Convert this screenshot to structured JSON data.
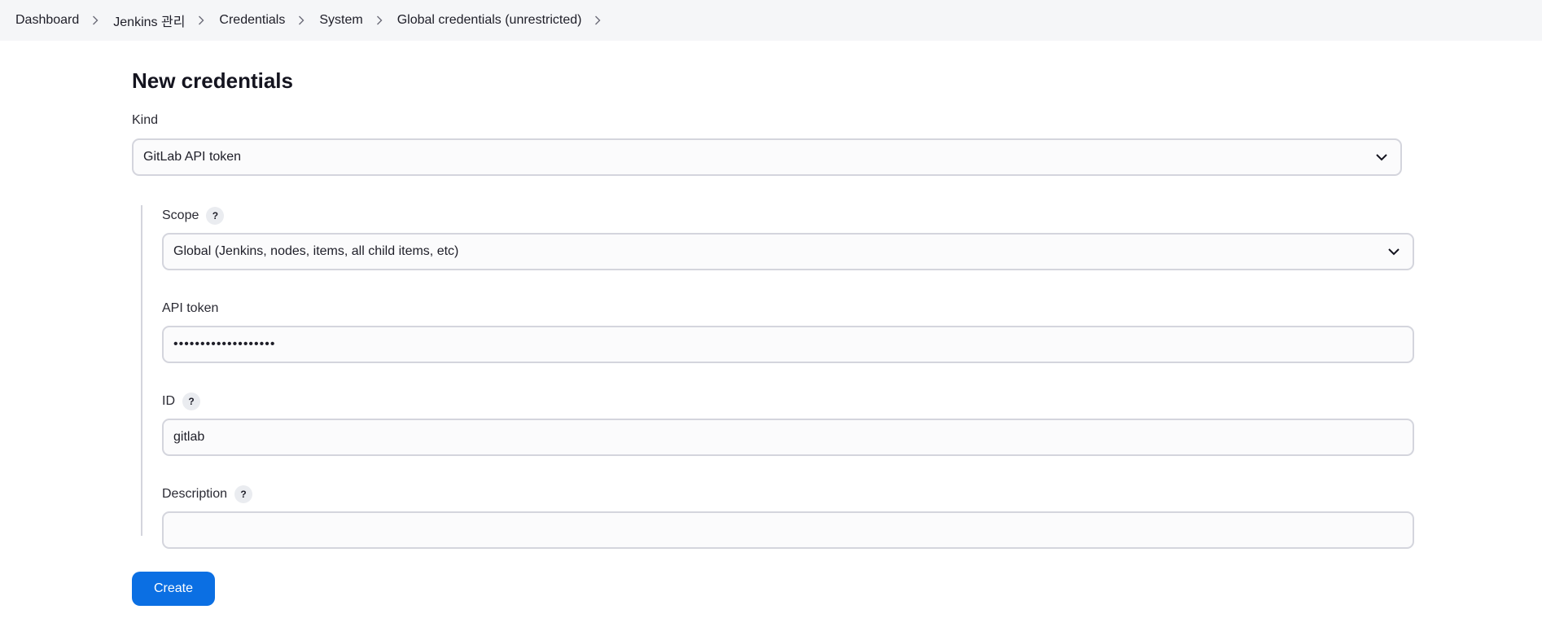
{
  "breadcrumb": [
    {
      "label": "Dashboard"
    },
    {
      "label": "Jenkins 관리"
    },
    {
      "label": "Credentials"
    },
    {
      "label": "System"
    },
    {
      "label": "Global credentials (unrestricted)"
    }
  ],
  "page": {
    "title": "New credentials"
  },
  "form": {
    "kind": {
      "label": "Kind",
      "value": "GitLab API token"
    },
    "scope": {
      "label": "Scope",
      "value": "Global (Jenkins, nodes, items, all child items, etc)",
      "help": "?"
    },
    "api_token": {
      "label": "API token",
      "value": "•••••••••••••••••••"
    },
    "id": {
      "label": "ID",
      "value": "gitlab",
      "help": "?"
    },
    "description": {
      "label": "Description",
      "value": "",
      "help": "?"
    }
  },
  "actions": {
    "create_label": "Create"
  },
  "colors": {
    "primary": "#0b6fe3",
    "topbar_bg": "#f5f6f8",
    "border": "#d4d5dd"
  },
  "icons": {
    "breadcrumb_separator": "chevron-right-icon",
    "select_caret": "chevron-down-icon"
  }
}
